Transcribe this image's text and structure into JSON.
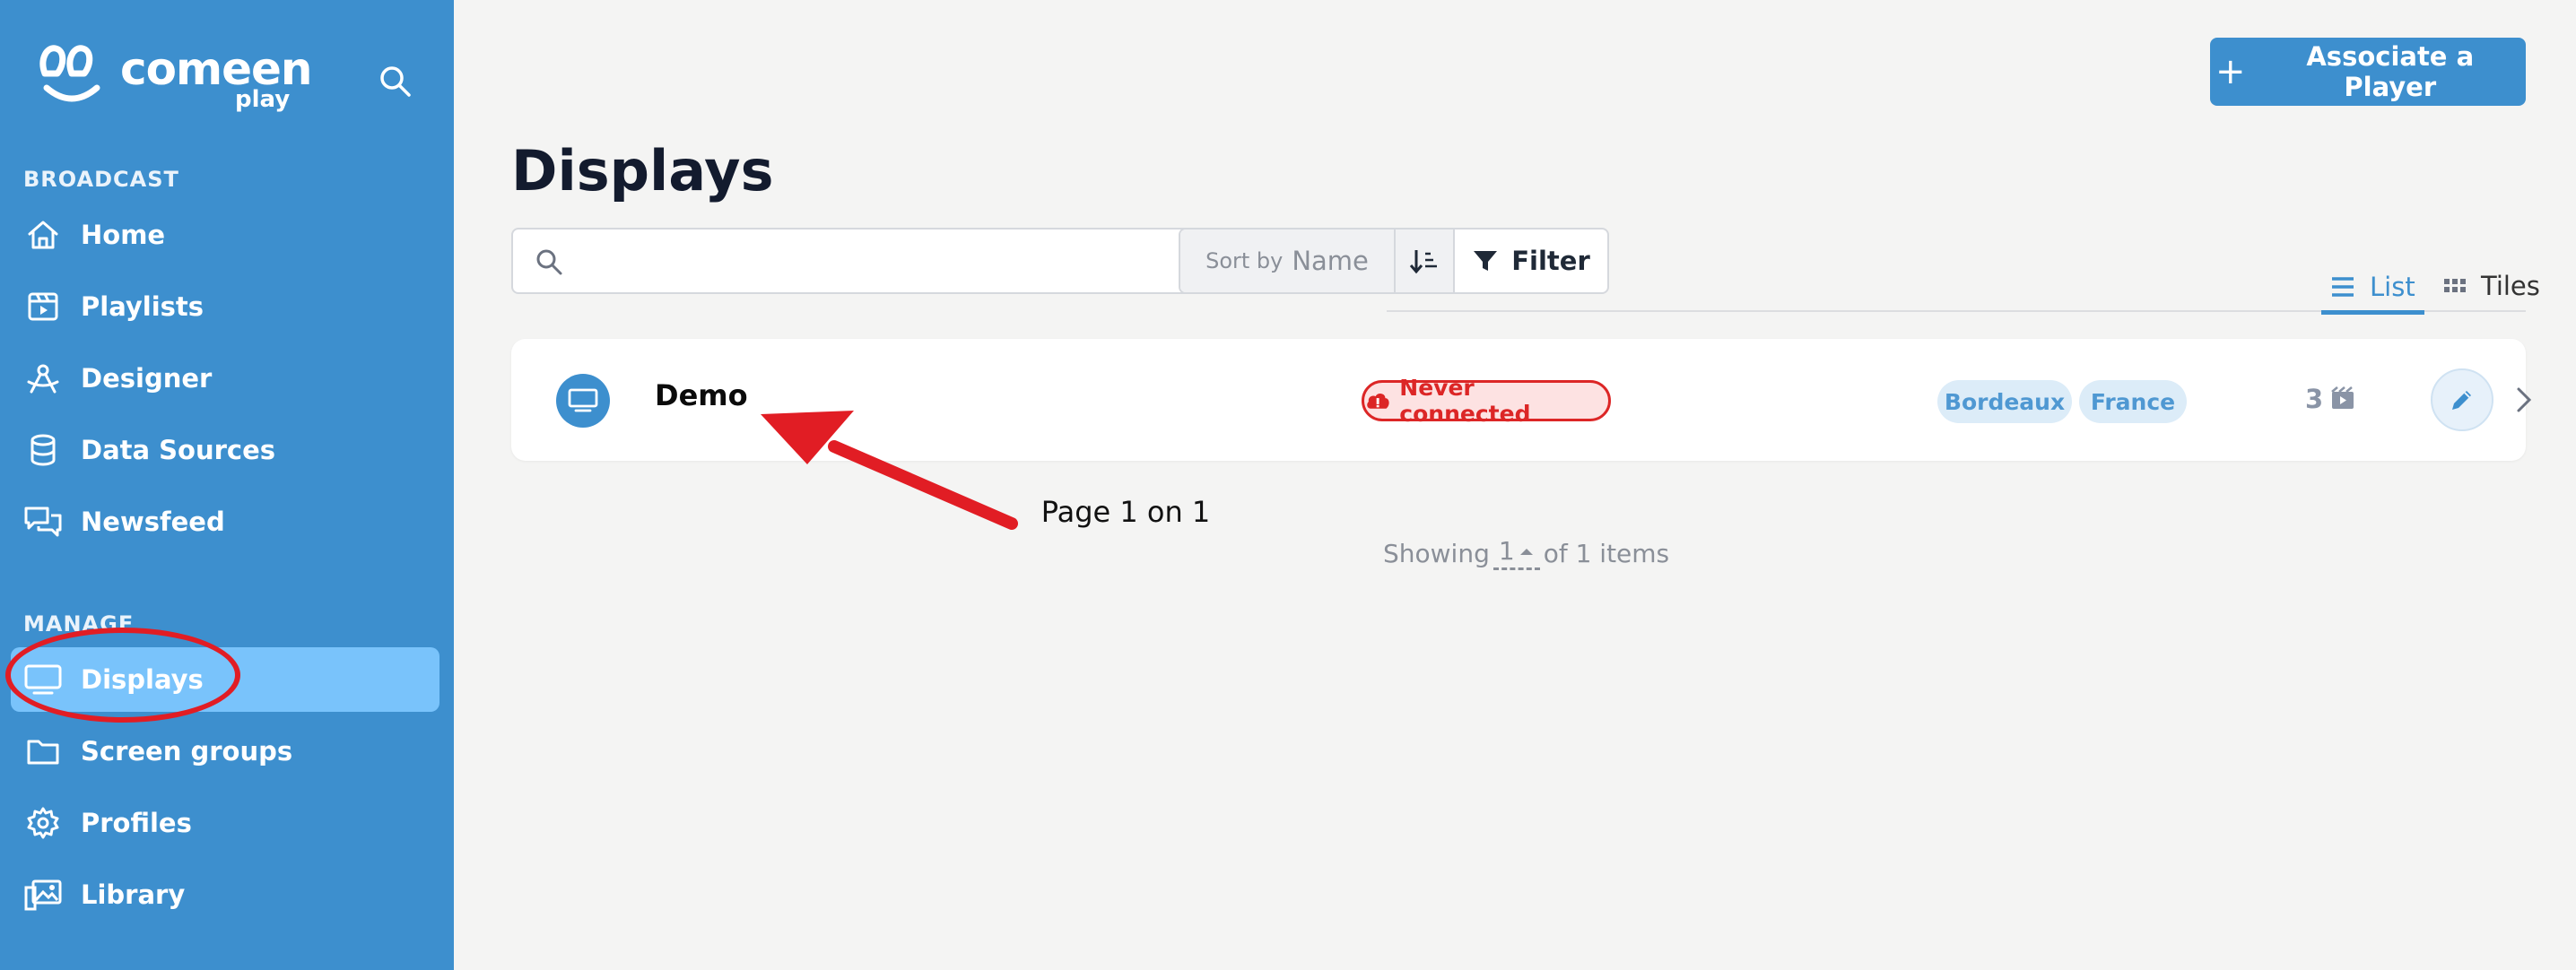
{
  "brand": {
    "name": "comeen",
    "sub": "play"
  },
  "sidebar": {
    "sections": [
      {
        "label": "BROADCAST",
        "items": [
          {
            "label": "Home",
            "icon": "home-icon"
          },
          {
            "label": "Playlists",
            "icon": "playlist-icon"
          },
          {
            "label": "Designer",
            "icon": "designer-icon"
          },
          {
            "label": "Data Sources",
            "icon": "database-icon"
          },
          {
            "label": "Newsfeed",
            "icon": "chat-icon"
          }
        ]
      },
      {
        "label": "MANAGE",
        "items": [
          {
            "label": "Displays",
            "icon": "monitor-icon",
            "active": true
          },
          {
            "label": "Screen groups",
            "icon": "folder-icon"
          },
          {
            "label": "Profiles",
            "icon": "gear-icon"
          },
          {
            "label": "Library",
            "icon": "images-icon"
          }
        ]
      }
    ]
  },
  "header": {
    "associate_label": "Associate a Player"
  },
  "page": {
    "title": "Displays"
  },
  "toolbar": {
    "search_placeholder": "",
    "sort_prefix": "Sort by",
    "sort_value": "Name",
    "filter_label": "Filter"
  },
  "view_tabs": {
    "list": "List",
    "tiles": "Tiles",
    "active": "list"
  },
  "rows": [
    {
      "name": "Demo",
      "status": "Never connected",
      "tags": [
        "Bordeaux",
        "France"
      ],
      "count": "3"
    }
  ],
  "pager": {
    "title": "Page 1 on 1",
    "showing_prefix": "Showing",
    "page_size": "1",
    "showing_suffix": "of 1 items"
  },
  "colors": {
    "sidebar": "#3d8fce",
    "active_item": "#79c3fb",
    "accent": "#3d8fce",
    "danger": "#dc2626",
    "annotation": "#e11d24"
  }
}
